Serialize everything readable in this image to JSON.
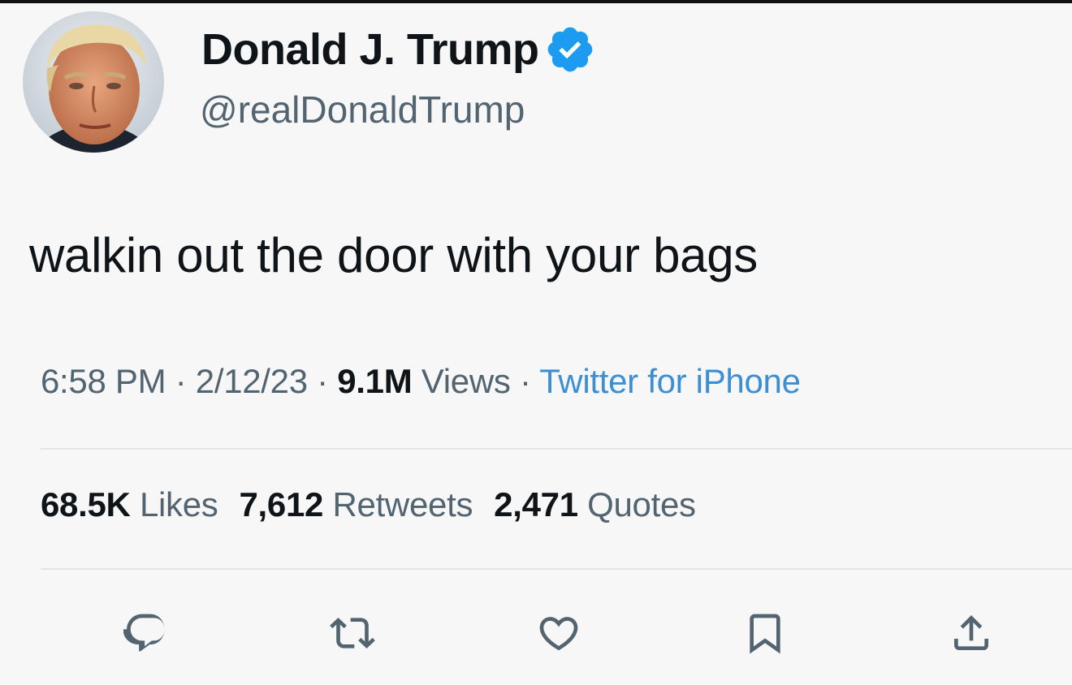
{
  "user": {
    "display_name": "Donald J. Trump",
    "handle": "@realDonaldTrump",
    "verified_icon": "verified-badge-icon",
    "avatar_icon": "profile-photo"
  },
  "tweet": {
    "text": "walkin out the door with your bags"
  },
  "meta": {
    "time": "6:58 PM",
    "sep1": " · ",
    "date": "2/12/23",
    "sep2": " · ",
    "views_count": "9.1M",
    "views_label": " Views",
    "sep3": " · ",
    "source": "Twitter for iPhone"
  },
  "stats": {
    "likes_count": "68.5K",
    "likes_label": " Likes",
    "retweets_count": "7,612",
    "retweets_label": " Retweets",
    "quotes_count": "2,471",
    "quotes_label": " Quotes"
  },
  "actions": [
    {
      "icon": "reply-icon"
    },
    {
      "icon": "retweet-icon"
    },
    {
      "icon": "like-icon"
    },
    {
      "icon": "bookmark-icon"
    },
    {
      "icon": "share-icon"
    }
  ],
  "colors": {
    "verified_blue": "#1d9bf0",
    "source_link": "#3b8fd2",
    "secondary_text": "#536471",
    "primary_text": "#0f1419"
  }
}
